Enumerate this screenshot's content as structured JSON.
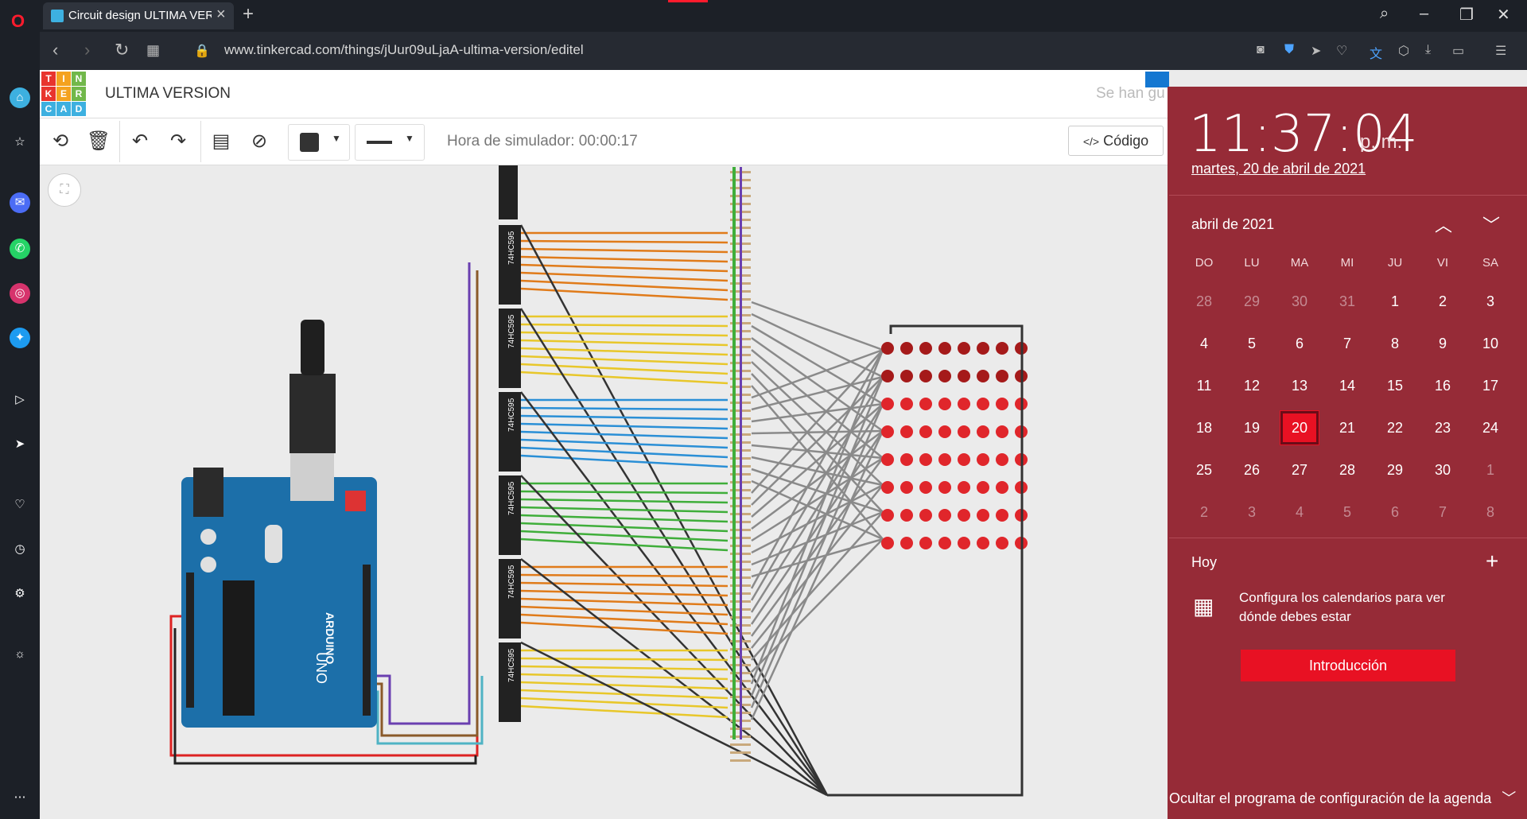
{
  "browser": {
    "tab_title": "Circuit design ULTIMA VERSION",
    "url": "www.tinkercad.com/things/jUur09uLjaA-ultima-version/editel",
    "new_tab_symbol": "+"
  },
  "app": {
    "logo_letters": [
      "T",
      "I",
      "N",
      "K",
      "E",
      "R",
      "C",
      "A",
      "D"
    ],
    "logo_colors": [
      "#e8342e",
      "#f4a21f",
      "#71b84a",
      "#e8342e",
      "#f4a21f",
      "#71b84a",
      "#3db0e0",
      "#3db0e0",
      "#3db0e0"
    ],
    "title": "ULTIMA VERSION",
    "saved_text": "Se han gu",
    "sim_time": "Hora de simulador: 00:00:17",
    "code_label": "Código"
  },
  "circuit": {
    "chip_label": "74HC595",
    "arduino_brand": "ARDUINO",
    "arduino_model": "UNO",
    "led_rows": 8,
    "led_cols": 8
  },
  "calendar": {
    "time": "11:37:04",
    "ampm": "p. m.",
    "date_text": "martes, 20 de abril de 2021",
    "month_label": "abril de 2021",
    "weekdays": [
      "DO",
      "LU",
      "MA",
      "MI",
      "JU",
      "VI",
      "SA"
    ],
    "weeks": [
      [
        "28",
        "29",
        "30",
        "31",
        "1",
        "2",
        "3"
      ],
      [
        "4",
        "5",
        "6",
        "7",
        "8",
        "9",
        "10"
      ],
      [
        "11",
        "12",
        "13",
        "14",
        "15",
        "16",
        "17"
      ],
      [
        "18",
        "19",
        "20",
        "21",
        "22",
        "23",
        "24"
      ],
      [
        "25",
        "26",
        "27",
        "28",
        "29",
        "30",
        "1"
      ],
      [
        "2",
        "3",
        "4",
        "5",
        "6",
        "7",
        "8"
      ]
    ],
    "today": "20",
    "hoy_label": "Hoy",
    "config_text": "Configura los calendarios para ver dónde debes estar",
    "intro_button": "Introducción",
    "hide_label": "Ocultar el programa de configuración de la agenda"
  },
  "colors": {
    "accent": "#962b37",
    "today": "#e81123"
  }
}
